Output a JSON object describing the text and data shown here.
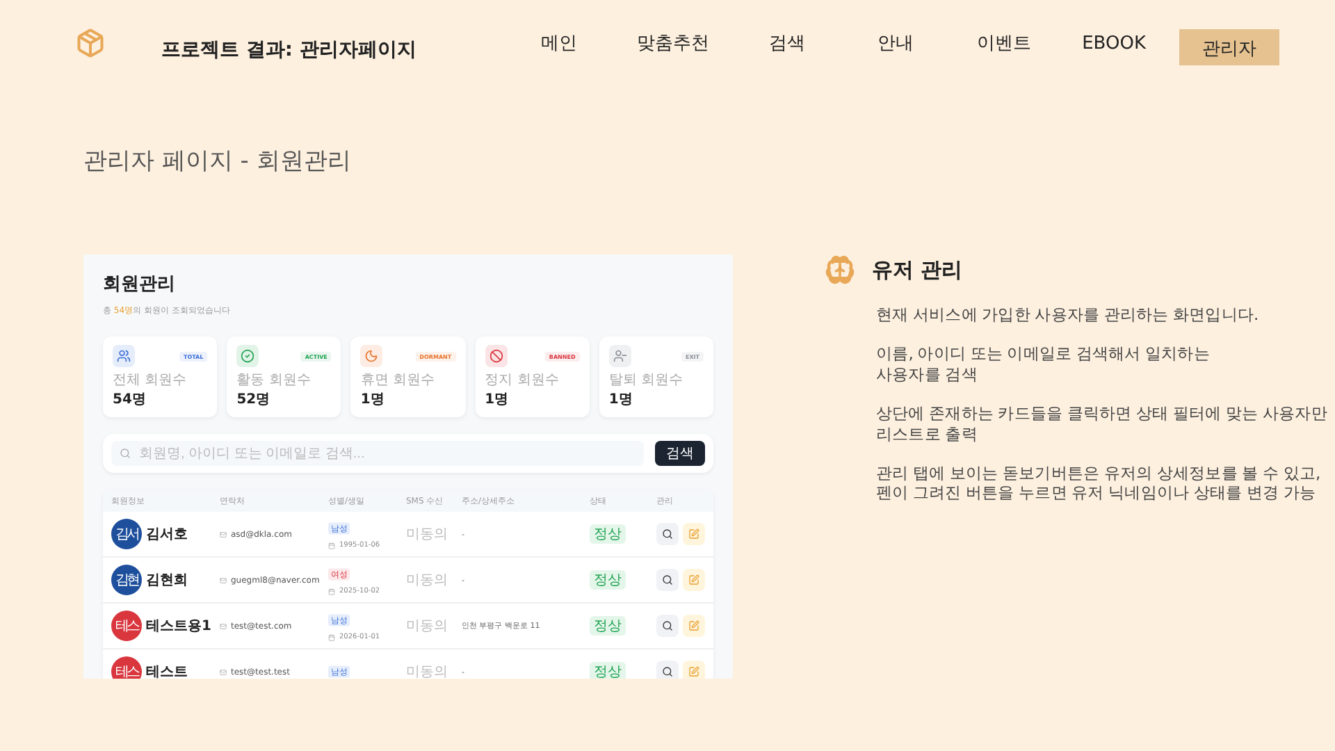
{
  "header": {
    "title": "프로젝트 결과: 관리자페이지",
    "nav": [
      {
        "label": "메인",
        "selected": false
      },
      {
        "label": "맞춤추천",
        "selected": false
      },
      {
        "label": "검색",
        "selected": false
      },
      {
        "label": "안내",
        "selected": false
      },
      {
        "label": "이벤트",
        "selected": false
      },
      {
        "label": "EBOOK",
        "selected": false
      },
      {
        "label": "관리자",
        "selected": true
      }
    ]
  },
  "page_title": "관리자 페이지 - 회원관리",
  "screenshot": {
    "title": "회원관리",
    "summary": "총 **54명**의 회원이 조회되었습니다",
    "cards": [
      {
        "kind": "total",
        "badge": "TOTAL",
        "label": "전체 회원수",
        "count": "54명",
        "color": "#3b6fd8"
      },
      {
        "kind": "active",
        "badge": "ACTIVE",
        "label": "활동 회원수",
        "count": "52명",
        "color": "#22a454"
      },
      {
        "kind": "dormant",
        "badge": "DORMANT",
        "label": "휴면 회원수",
        "count": "1명",
        "color": "#e8742c"
      },
      {
        "kind": "banned",
        "badge": "BANNED",
        "label": "정지 회원수",
        "count": "1명",
        "color": "#d9363e"
      },
      {
        "kind": "exit",
        "badge": "EXIT",
        "label": "탈퇴 회원수",
        "count": "1명",
        "color": "#8a8f98"
      }
    ],
    "search": {
      "placeholder": "회원명, 아이디 또는 이메일로 검색...",
      "button": "검색"
    },
    "columns": [
      "회원정보",
      "연락처",
      "성별/생일",
      "SMS 수신",
      "주소/상세주소",
      "상태",
      "관리"
    ],
    "rows": [
      {
        "avatar": "김서",
        "color": "#1e4f9c",
        "name": "김서호",
        "email": "asd@dkla.com",
        "gender": "남성",
        "kind": "male",
        "birth": "1995-01-06",
        "sms": "미동의",
        "address": "-",
        "status": "정상"
      },
      {
        "avatar": "김현",
        "color": "#1e4f9c",
        "name": "김현희",
        "email": "guegml8@naver.com",
        "gender": "여성",
        "kind": "female",
        "birth": "2025-10-02",
        "sms": "미동의",
        "address": "-",
        "status": "정상"
      },
      {
        "avatar": "테스",
        "color": "#d9363e",
        "name": "테스트용1",
        "email": "test@test.com",
        "gender": "남성",
        "kind": "male",
        "birth": "2026-01-01",
        "sms": "미동의",
        "address": "인천 부평구 백운로 11",
        "status": "정상"
      },
      {
        "avatar": "테스",
        "color": "#d9363e",
        "name": "테스트",
        "email": "test@test.test",
        "gender": "남성",
        "kind": "male",
        "sms": "미동의",
        "address": "-",
        "status": "정상"
      }
    ]
  },
  "feature": {
    "title": "유저 관리",
    "paragraphs": [
      "현재 서비스에 가입한 사용자를 관리하는 화면입니다.",
      "이름, 아이디 또는 이메일로 검색해서 일치하는\n사용자를 검색",
      "상단에 존재하는 카드들을 클릭하면 상태 필터에 맞는 사용자만\n리스트로 출력",
      "관리 탭에 보이는 돋보기버튼은 유저의 상세정보를 볼 수 있고,\n펜이 그려진 버튼을 누르면 유저 닉네임이나 상태를 변경 가능"
    ]
  }
}
